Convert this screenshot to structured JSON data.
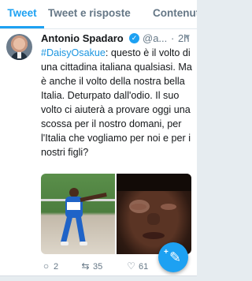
{
  "tabs": [
    {
      "label": "Tweet",
      "selected": true
    },
    {
      "label": "Tweet e risposte",
      "selected": false
    },
    {
      "label": "Contenuti",
      "selected": false
    }
  ],
  "colors": {
    "accent": "#1da1f2",
    "text": "#14171a",
    "muted": "#657786",
    "hashtag": "#1b95e0"
  },
  "tweet": {
    "author_name": "Antonio Spadaro",
    "verified": true,
    "handle": "@a...",
    "separator": "·",
    "time": "2h",
    "hashtag": "#DaisyOsakue",
    "text": ":  questo è il volto di una cittadina italiana qualsiasi. Ma è anche il volto della nostra bella Italia. Deturpato dall'odio. Il suo volto ci aiuterà a provare oggi una scossa per il nostro domani, per l'Italia che vogliamo per noi e per i nostri figli?",
    "reply_count": "2",
    "retweet_count": "35",
    "like_count": "61"
  },
  "icons": {
    "verified": "verified-badge-icon",
    "menu": "chevron-down-icon",
    "reply": "reply-icon",
    "retweet": "retweet-icon",
    "like": "heart-icon",
    "compose": "compose-tweet-icon"
  }
}
